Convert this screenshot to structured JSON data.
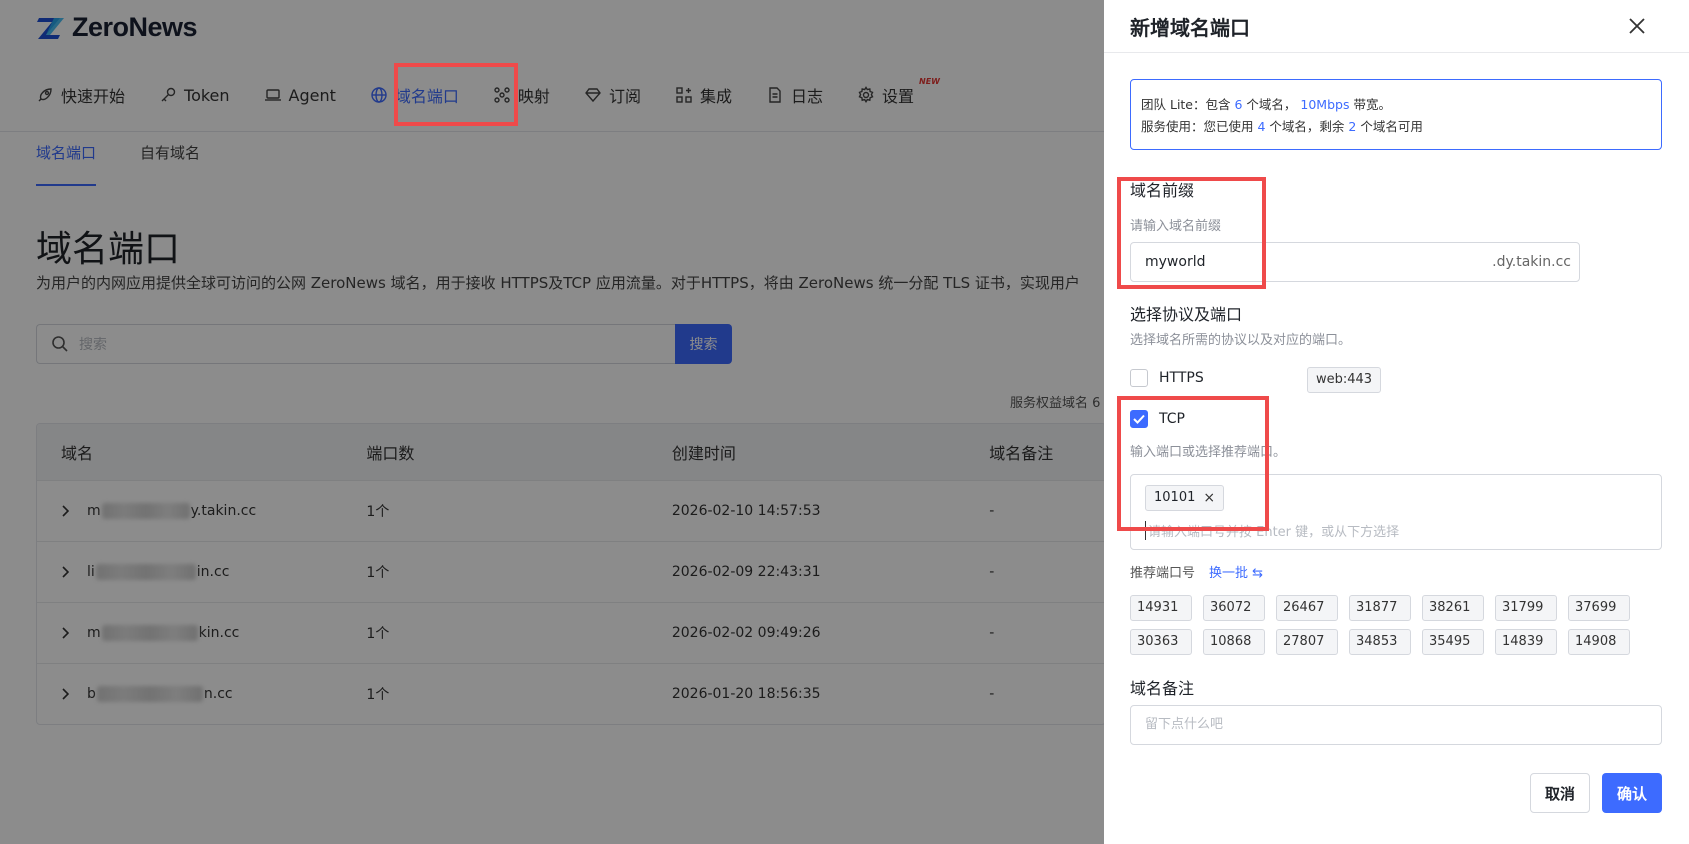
{
  "app": {
    "logo_text": "ZeroNews"
  },
  "nav": {
    "items": [
      {
        "label": "快速开始",
        "icon": "rocket-icon"
      },
      {
        "label": "Token",
        "icon": "key-icon"
      },
      {
        "label": "Agent",
        "icon": "laptop-icon"
      },
      {
        "label": "域名端口",
        "icon": "globe-icon",
        "active": true
      },
      {
        "label": "映射",
        "icon": "network-icon"
      },
      {
        "label": "订阅",
        "icon": "diamond-icon"
      },
      {
        "label": "集成",
        "icon": "grid-plus-icon"
      },
      {
        "label": "日志",
        "icon": "document-icon"
      },
      {
        "label": "设置",
        "icon": "gear-icon",
        "badge": "NEW"
      }
    ]
  },
  "subtabs": [
    {
      "label": "域名端口",
      "active": true
    },
    {
      "label": "自有域名"
    }
  ],
  "page": {
    "title": "域名端口",
    "description": "为用户的内网应用提供全球可访问的公网 ZeroNews 域名，用于接收 HTTPS及TCP 应用流量。对于HTTPS，将由 ZeroNews 统一分配 TLS 证书，实现用户"
  },
  "search": {
    "placeholder": "搜索",
    "button": "搜索"
  },
  "quota_text": "服务权益域名 6",
  "table": {
    "headers": [
      "域名",
      "端口数",
      "创建时间",
      "域名备注"
    ],
    "rows": [
      {
        "prefix": "m",
        "suffix": "y.takin.cc",
        "ports": "1个",
        "created": "2026-02-10 14:57:53",
        "remark": "-"
      },
      {
        "prefix": "li",
        "suffix": "in.cc",
        "ports": "1个",
        "created": "2026-02-09 22:43:31",
        "remark": "-"
      },
      {
        "prefix": "m",
        "suffix": "kin.cc",
        "ports": "1个",
        "created": "2026-02-02 09:49:26",
        "remark": "-"
      },
      {
        "prefix": "b",
        "suffix": "n.cc",
        "ports": "1个",
        "created": "2026-01-20 18:56:35",
        "remark": "-"
      }
    ]
  },
  "drawer": {
    "title": "新增域名端口",
    "info": {
      "line1_a": "团队 Lite：包含 ",
      "line1_count": "6",
      "line1_b": " 个域名， ",
      "line1_bw": "10Mbps",
      "line1_c": " 带宽。",
      "line2_a": "服务使用：您已使用 ",
      "line2_used": "4",
      "line2_b": " 个域名，剩余 ",
      "line2_left": "2",
      "line2_c": " 个域名可用"
    },
    "prefix": {
      "label": "域名前缀",
      "hint": "请输入域名前缀",
      "value": "myworld",
      "suffix": ".dy.takin.cc"
    },
    "protocol": {
      "label": "选择协议及端口",
      "hint": "选择域名所需的协议以及对应的端口。",
      "https_label": "HTTPS",
      "https_port": "web:443",
      "https_checked": false,
      "tcp_label": "TCP",
      "tcp_checked": true,
      "tcp_hint": "输入端口或选择推荐端口。",
      "selected_port": "10101",
      "input_placeholder": "请输入端口号并按 Enter 键，或从下方选择"
    },
    "recommend": {
      "label": "推荐端口号",
      "switch_label": "换一批 ⇆",
      "ports": [
        "14931",
        "36072",
        "26467",
        "31877",
        "38261",
        "31799",
        "37699",
        "30363",
        "10868",
        "27807",
        "34853",
        "35495",
        "14839",
        "14908"
      ]
    },
    "remark": {
      "label": "域名备注",
      "placeholder": "留下点什么吧"
    },
    "buttons": {
      "cancel": "取消",
      "ok": "确认"
    }
  },
  "colors": {
    "accent": "#3d6bff",
    "highlight": "#ef4a4a"
  }
}
